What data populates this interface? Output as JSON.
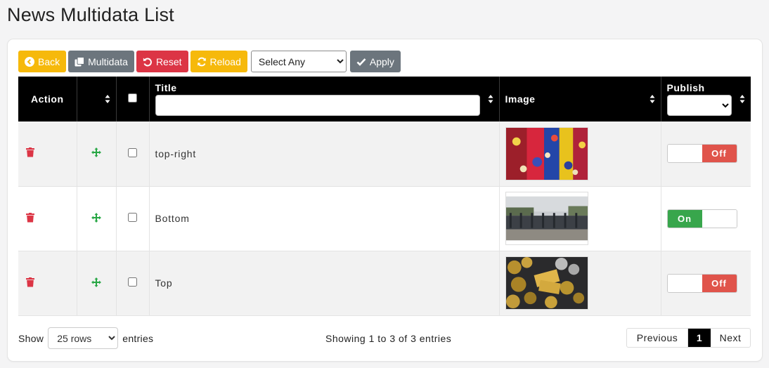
{
  "page": {
    "title": "News Multidata List"
  },
  "toolbar": {
    "back_label": "Back",
    "multidata_label": "Multidata",
    "reset_label": "Reset",
    "reload_label": "Reload",
    "select_value": "Select Any",
    "apply_label": "Apply"
  },
  "table": {
    "columns": {
      "action": "Action",
      "title": "Title",
      "image": "Image",
      "publish": "Publish"
    },
    "rows": [
      {
        "title": "top-right",
        "image": "crowd-flags-photo",
        "publish": "Off"
      },
      {
        "title": "Bottom",
        "image": "police-line-photo",
        "publish": "On"
      },
      {
        "title": "Top",
        "image": "gold-coins-photo",
        "publish": "Off"
      }
    ]
  },
  "footer": {
    "show_label": "Show",
    "rows_value": "25 rows",
    "entries_label": "entries",
    "info": "Showing 1 to 3 of 3 entries",
    "prev_label": "Previous",
    "current_page": "1",
    "next_label": "Next"
  },
  "colors": {
    "warning": "#f6b90b",
    "danger": "#dc3545",
    "secondary": "#6c757d",
    "success": "#38a64c",
    "off": "#e0544b",
    "move": "#28a745"
  },
  "icons": {
    "back": "circle-chevron-left-icon",
    "multidata": "copy-icon",
    "reset": "undo-icon",
    "reload": "sync-icon",
    "apply": "check-icon",
    "delete": "trash-icon",
    "move": "arrows-move-icon",
    "sort": "sort-icon"
  }
}
